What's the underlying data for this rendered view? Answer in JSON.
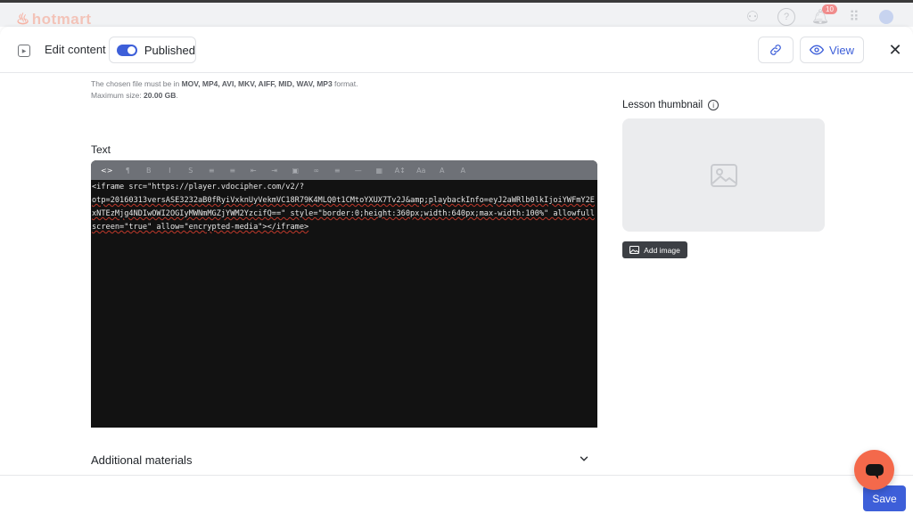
{
  "background_app": {
    "logo_text": "hotmart",
    "notification_count": "10"
  },
  "header": {
    "title": "Edit content",
    "published_label": "Published",
    "published_on": true,
    "view_label": "View"
  },
  "upload": {
    "note_prefix": "The chosen file must be in ",
    "formats": "MOV, MP4, AVI, MKV, AIFF, MID, WAV, MP3",
    "note_suffix": " format.",
    "max_prefix": "Maximum size: ",
    "max_size": "20.00 GB",
    "max_suffix": "."
  },
  "text_section": {
    "label": "Text",
    "toolbar": [
      {
        "icon": "code-view-icon",
        "glyph": "<>"
      },
      {
        "icon": "paragraph-icon",
        "glyph": "¶"
      },
      {
        "icon": "bold-icon",
        "glyph": "B"
      },
      {
        "icon": "italic-icon",
        "glyph": "I"
      },
      {
        "icon": "strikethrough-icon",
        "glyph": "S"
      },
      {
        "icon": "ordered-list-icon",
        "glyph": "≡"
      },
      {
        "icon": "bullet-list-icon",
        "glyph": "≡"
      },
      {
        "icon": "outdent-icon",
        "glyph": "⇤"
      },
      {
        "icon": "indent-icon",
        "glyph": "⇥"
      },
      {
        "icon": "image-icon",
        "glyph": "▣"
      },
      {
        "icon": "link-icon",
        "glyph": "∞"
      },
      {
        "icon": "align-icon",
        "glyph": "≡"
      },
      {
        "icon": "horizontal-rule-icon",
        "glyph": "—"
      },
      {
        "icon": "table-icon",
        "glyph": "▦"
      },
      {
        "icon": "font-size-icon",
        "glyph": "A↕"
      },
      {
        "icon": "font-family-icon",
        "glyph": "Aa"
      },
      {
        "icon": "text-color-icon",
        "glyph": "A"
      },
      {
        "icon": "highlight-icon",
        "glyph": "A"
      }
    ],
    "code_line1": "<iframe src=\"https://player.vdocipher.com/v2/?",
    "code_line2": "otp=20160313versASE3232aB0fRyiVxknUyVekmVC18R79K4MLQ0t1CMtoYXUX7Tv2J&amp;playbackInfo=eyJ2aWRlb0lkIjoiYWFmY2ExNTEzMjg4NDIwOWI2OGIyMWNmMGZjYWM2YzcifQ==\" style=\"border:0;height:360px;width:640px;max-width:100%\" allowfullscreen=\"true\" allow=\"encrypted-media\"></iframe>"
  },
  "additional_materials": {
    "label": "Additional materials"
  },
  "thumbnail": {
    "label": "Lesson thumbnail",
    "add_image_label": "Add image"
  },
  "footer": {
    "save_label": "Save"
  },
  "colors": {
    "accent": "#3d5fd9",
    "editor_bg": "#121212",
    "toolbar_bg": "#6e7177",
    "chat_fab": "#f4694b"
  }
}
